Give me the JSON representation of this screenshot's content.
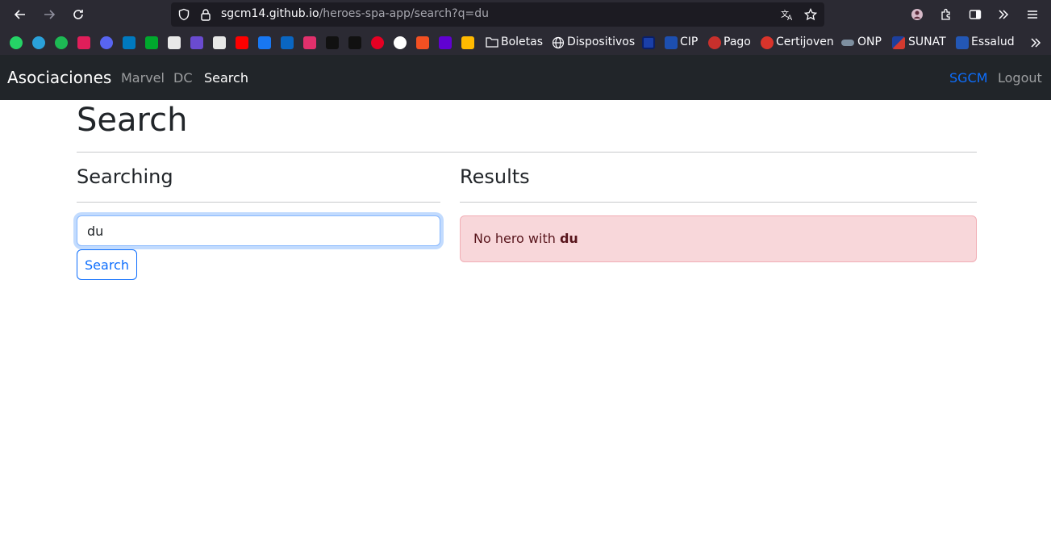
{
  "browser": {
    "url_host": "sgcm14.github.io",
    "url_path": "/heroes-spa-app/search?q=du",
    "bookmarks": [
      {
        "icon": "whatsapp-icon",
        "color": "#25d366"
      },
      {
        "icon": "telegram-icon",
        "color": "#2aa1da"
      },
      {
        "icon": "spotify-icon",
        "color": "#1db954"
      },
      {
        "icon": "slack-icon",
        "color": "#e01e5a"
      },
      {
        "icon": "discord-icon",
        "color": "#5865f2"
      },
      {
        "icon": "trello-icon",
        "color": "#0079bf"
      },
      {
        "icon": "evernote-icon",
        "color": "#00a82d"
      },
      {
        "icon": "openai-icon",
        "color": "#e8e8e8"
      },
      {
        "icon": "r-icon",
        "color": "#6a4bd0"
      },
      {
        "icon": "github-icon",
        "color": "#e8e8e8"
      },
      {
        "icon": "youtube-icon",
        "color": "#ff0000"
      },
      {
        "icon": "facebook-icon",
        "color": "#1877f2"
      },
      {
        "icon": "linkedin-icon",
        "color": "#0a66c2"
      },
      {
        "icon": "instagram-icon",
        "color": "#e1306c"
      },
      {
        "icon": "tiktok-icon",
        "color": "#111111"
      },
      {
        "icon": "x-icon",
        "color": "#111111"
      },
      {
        "icon": "pinterest-icon",
        "color": "#e60023"
      },
      {
        "icon": "google-icon",
        "color": "#ffffff"
      },
      {
        "icon": "microsoft-icon",
        "color": "#f25022"
      },
      {
        "icon": "yahoo-mail-icon",
        "color": "#6001d2"
      },
      {
        "icon": "microsoft365-icon",
        "color": "#ffb900"
      }
    ],
    "bookmark_labels": {
      "boletas": "Boletas",
      "dispositivos": "Dispositivos",
      "cip": "CIP",
      "pago": "Pago",
      "certijoven": "Certijoven",
      "onp": "ONP",
      "sunat": "SUNAT",
      "essalud": "Essalud"
    }
  },
  "navbar": {
    "brand": "Asociaciones",
    "links": [
      "Marvel",
      "DC",
      "Search"
    ],
    "user": "SGCM",
    "logout": "Logout"
  },
  "page": {
    "title": "Search",
    "searching_title": "Searching",
    "results_title": "Results",
    "search_value": "du",
    "search_button": "Search",
    "alert_prefix": "No hero with",
    "alert_term": "du"
  },
  "colors": {
    "navbar_bg": "#212529",
    "primary": "#0d6efd",
    "alert_bg": "#f8d7da",
    "alert_text": "#58151c"
  }
}
